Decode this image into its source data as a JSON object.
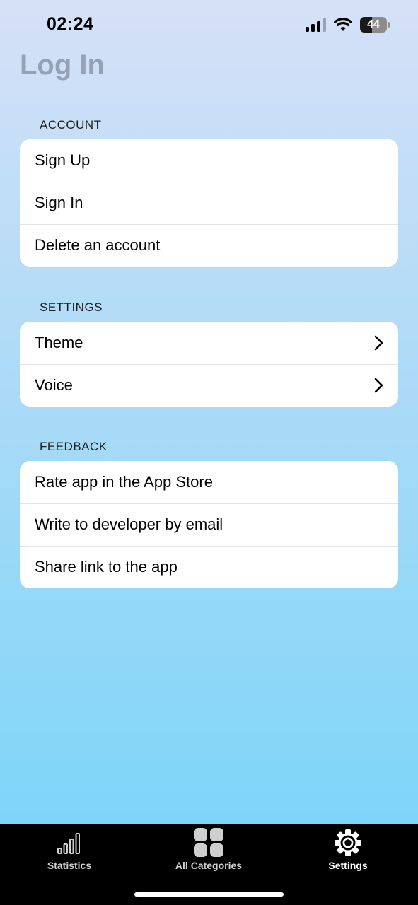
{
  "status_bar": {
    "time": "02:24",
    "battery": "44",
    "battery_level": 0.44,
    "cellular_bars": 3,
    "cellular_bars_total": 4
  },
  "header": {
    "title": "Log In"
  },
  "sections": [
    {
      "title": "ACCOUNT",
      "items": [
        {
          "label": "Sign Up"
        },
        {
          "label": "Sign In"
        },
        {
          "label": "Delete an account"
        }
      ]
    },
    {
      "title": "SETTINGS",
      "items": [
        {
          "label": "Theme"
        },
        {
          "label": "Voice"
        }
      ]
    },
    {
      "title": "FEEDBACK",
      "items": [
        {
          "label": "Rate app in the App Store"
        },
        {
          "label": "Write to developer by email"
        },
        {
          "label": "Share link to the app"
        }
      ]
    }
  ],
  "tab_bar": {
    "tabs": [
      {
        "label": "Statistics",
        "icon": "bar-chart-icon",
        "active": false
      },
      {
        "label": "All Categories",
        "icon": "grid-icon",
        "active": false
      },
      {
        "label": "Settings",
        "icon": "gear-icon",
        "active": true
      }
    ],
    "active_color": "#ffffff",
    "inactive_color": "#cfcfcf"
  },
  "colors": {
    "title": "#94a2b6",
    "tab_bar_background": "#000000"
  }
}
